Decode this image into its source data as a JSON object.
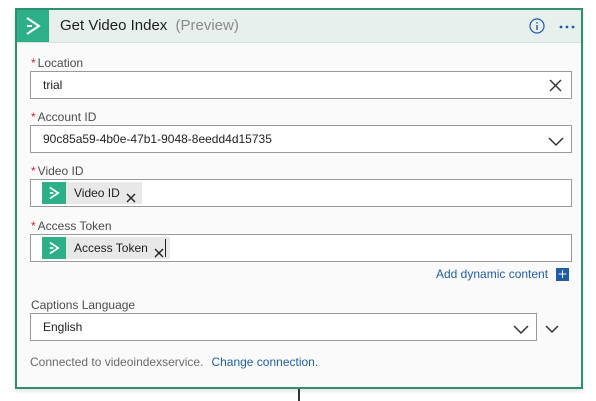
{
  "header": {
    "title": "Get Video Index",
    "badge": "(Preview)",
    "logo_icon": "video-indexer-icon",
    "info_icon": "info-icon",
    "more_icon": "more-options-icon"
  },
  "fields": {
    "location": {
      "label": "Location",
      "required": "*",
      "value": "trial"
    },
    "account_id": {
      "label": "Account ID",
      "required": "*",
      "value": "90c85a59-4b0e-47b1-9048-8eedd4d15735"
    },
    "video_id": {
      "label": "Video ID",
      "required": "*",
      "token": "Video ID"
    },
    "access_token": {
      "label": "Access Token",
      "required": "*",
      "token": "Access Token"
    },
    "captions_language": {
      "label": "Captions Language",
      "value": "English"
    }
  },
  "dynamic_content": {
    "label": "Add dynamic content",
    "plus": "+"
  },
  "footer": {
    "connected_text": "Connected to videoindexservice.",
    "change_label": "Change connection."
  },
  "colors": {
    "accent": "#2db08a",
    "border": "#2f8f6e",
    "link": "#1f5da9",
    "required": "#d3262e"
  }
}
